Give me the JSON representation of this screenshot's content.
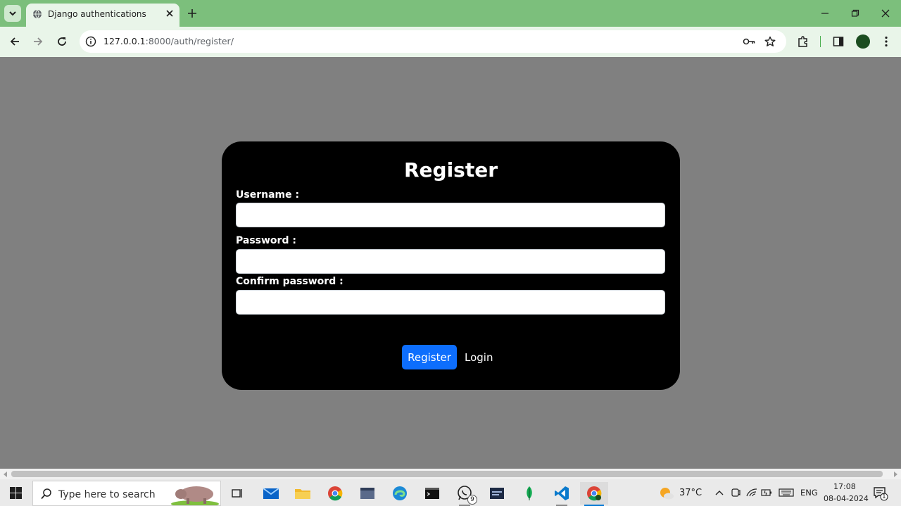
{
  "browser": {
    "tab": {
      "title": "Django authentications"
    },
    "url": {
      "host": "127.0.0.1",
      "rest": ":8000/auth/register/"
    }
  },
  "form": {
    "title": "Register",
    "fields": [
      {
        "label": "Username :",
        "value": ""
      },
      {
        "label": "Password :",
        "value": ""
      },
      {
        "label": "Confirm password :",
        "value": ""
      }
    ],
    "submit_label": "Register",
    "login_link": "Login",
    "colors": {
      "card": "#000000",
      "submit": "#0d6efd",
      "page_bg": "#808080"
    }
  },
  "taskbar": {
    "search_placeholder": "Type here to search",
    "whatsapp_badge": "9",
    "weather": "37°C",
    "language": "ENG",
    "time": "17:08",
    "date": "08-04-2024",
    "notification_count": "1"
  },
  "icons": [
    "tab-search-icon",
    "globe-icon",
    "close-icon",
    "plus-icon",
    "minimize-icon",
    "restore-icon",
    "back-icon",
    "forward-icon",
    "reload-icon",
    "info-icon",
    "key-icon",
    "star-icon",
    "extensions-icon",
    "sidepanel-icon",
    "menu-icon",
    "windows-icon",
    "search-icon"
  ]
}
